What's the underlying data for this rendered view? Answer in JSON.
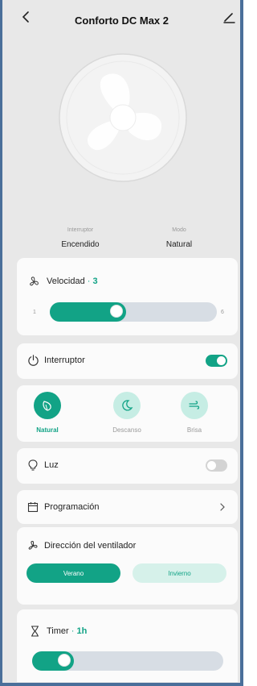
{
  "header": {
    "title": "Conforto DC Max 2"
  },
  "status": {
    "power": {
      "label": "Interruptor",
      "value": "Encendido"
    },
    "mode": {
      "label": "Modo",
      "value": "Natural"
    }
  },
  "speed": {
    "label": "Velocidad",
    "value": "3",
    "min_label": "1",
    "max_label": "6",
    "level_fraction": 0.4
  },
  "power_switch": {
    "label": "Interruptor",
    "on": true
  },
  "modes": [
    {
      "label": "Natural",
      "icon": "leaf-icon",
      "active": true
    },
    {
      "label": "Descanso",
      "icon": "moon-icon",
      "active": false
    },
    {
      "label": "Brisa",
      "icon": "wind-icon",
      "active": false
    }
  ],
  "light": {
    "label": "Luz",
    "on": false
  },
  "schedule": {
    "label": "Programación"
  },
  "direction": {
    "label": "Dirección del ventilador",
    "options": [
      {
        "label": "Verano",
        "active": true
      },
      {
        "label": "Invierno",
        "active": false
      }
    ]
  },
  "timer": {
    "label": "Timer",
    "value": "1h",
    "level_fraction": 0.17
  },
  "colors": {
    "accent": "#12a386",
    "accent_light": "#c6ede4",
    "background": "#e8e8e8",
    "card": "#fbfbfb"
  }
}
